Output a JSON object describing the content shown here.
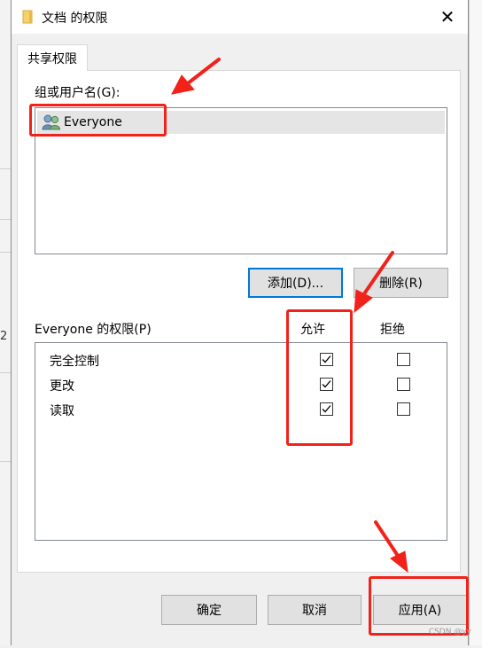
{
  "window": {
    "title": "文档 的权限",
    "close_label": "✕"
  },
  "tabs": [
    {
      "label": "共享权限"
    }
  ],
  "group_label": "组或用户名(G):",
  "users": [
    {
      "name": "Everyone",
      "icon": "users-icon"
    }
  ],
  "buttons": {
    "add": "添加(D)...",
    "remove": "删除(R)",
    "ok": "确定",
    "cancel": "取消",
    "apply": "应用(A)"
  },
  "permissions": {
    "label": "Everyone 的权限(P)",
    "allow_header": "允许",
    "deny_header": "拒绝",
    "rows": [
      {
        "name": "完全控制",
        "allow": true,
        "deny": false
      },
      {
        "name": "更改",
        "allow": true,
        "deny": false
      },
      {
        "name": "读取",
        "allow": true,
        "deny": false
      }
    ]
  },
  "background": {
    "left_char": "2",
    "bottom_text": "应用"
  },
  "watermark": "CSDN @yy",
  "annotation_color": "#f2211a",
  "accent_color": "#0078d7"
}
